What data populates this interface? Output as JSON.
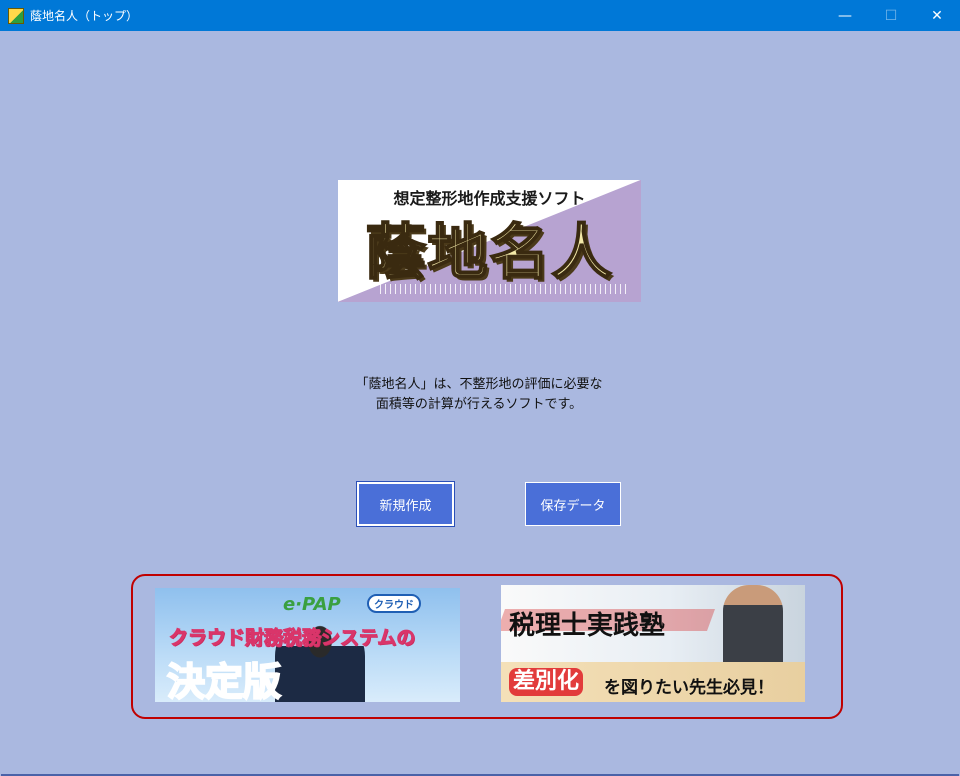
{
  "window": {
    "title": "蔭地名人（トップ）",
    "minimize_glyph": "—",
    "maximize_glyph": "☐",
    "close_glyph": "✕"
  },
  "logo": {
    "subtitle": "想定整形地作成支援ソフト",
    "main": "蔭地名人"
  },
  "description": {
    "line1": "「蔭地名人」は、不整形地の評価に必要な",
    "line2": "面積等の計算が行えるソフトです。"
  },
  "buttons": {
    "new": "新規作成",
    "saved": "保存データ"
  },
  "banners": {
    "left": {
      "logo": "e·PAP",
      "badge": "クラウド",
      "line1": "クラウド財務税務システムの",
      "line2": "決定版"
    },
    "right": {
      "title": "税理士実践塾",
      "tag": "差別化",
      "rest": "を図りたい先生必見！"
    }
  },
  "colors": {
    "titlebar": "#0078d7",
    "background": "#aab8e0",
    "button": "#4a6fd8",
    "ad_frame": "#c00000"
  }
}
